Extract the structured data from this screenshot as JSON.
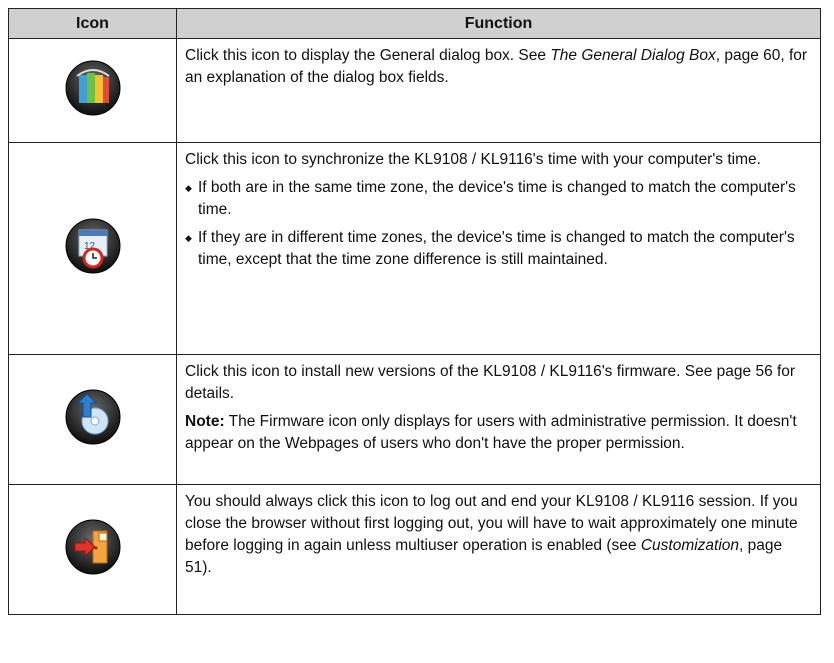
{
  "header": {
    "icon_col": "Icon",
    "function_col": "Function"
  },
  "rows": [
    {
      "icon": "general-settings-books-icon",
      "text_before": "Click this icon to display the General dialog box. See ",
      "link": "The General Dialog Box",
      "text_after": ", page 60, for an explanation of the dialog box fields."
    },
    {
      "icon": "time-sync-calendar-clock-icon",
      "intro": "Click this icon to synchronize the KL9108 / KL9116's time with your computer's time.",
      "bullets": [
        "If both are in the same time zone, the device's time is changed to match the computer's time.",
        "If they are in different time zones, the device's time is changed to match the computer's time, except that the time zone difference is still maintained."
      ]
    },
    {
      "icon": "firmware-upgrade-disc-icon",
      "intro": "Click this icon to install new versions of the KL9108 / KL9116's firmware. See page 56 for details.",
      "note_label": "Note:",
      "note_text": " The Firmware icon only displays for users with administrative permission. It doesn't appear on the Webpages of users who don't have the proper permission."
    },
    {
      "icon": "logout-exit-door-icon",
      "text_before": "You should always click this icon to log out and end your KL9108 / KL9116 session. If you close the browser without first logging out, you will have to wait approximately one minute before logging in again unless multiuser operation is enabled (see ",
      "link": "Customization",
      "text_after": ", page 51)."
    }
  ]
}
